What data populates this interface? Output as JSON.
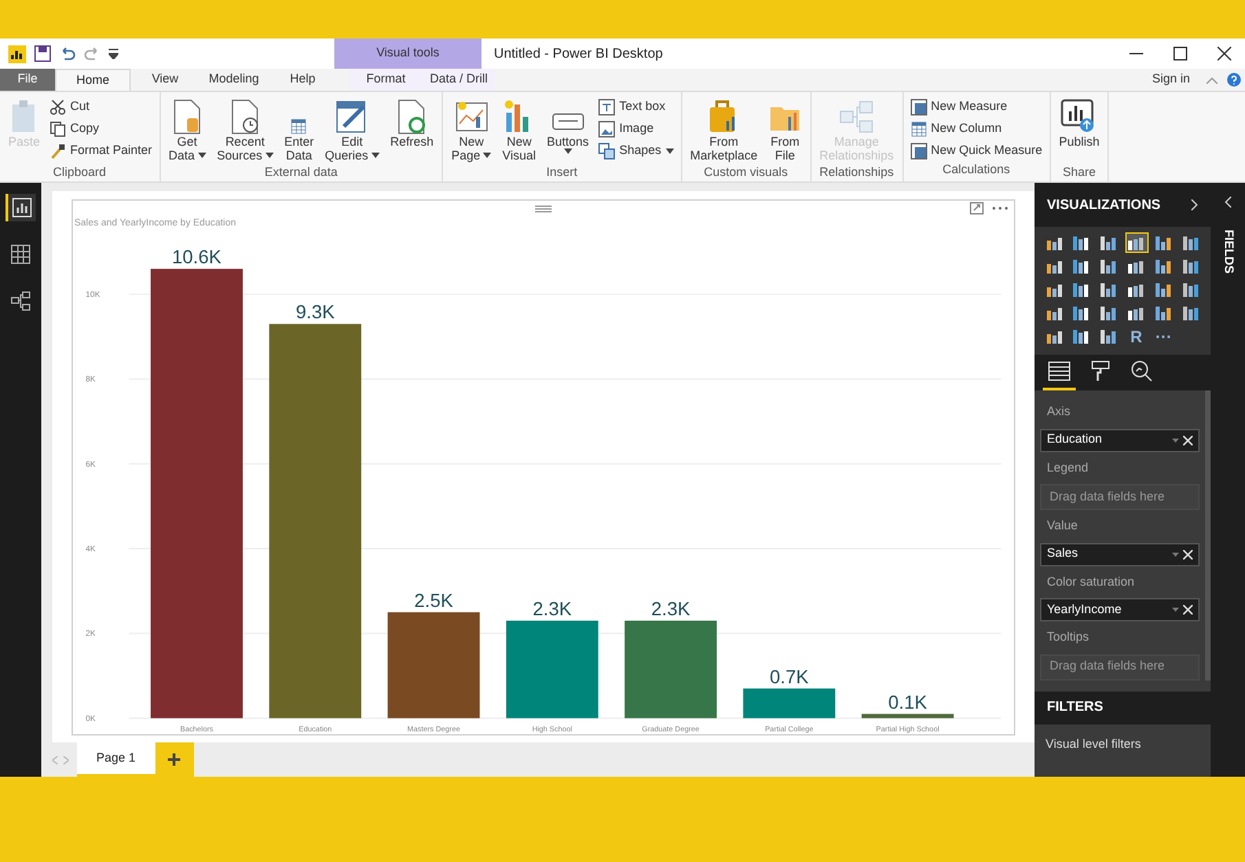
{
  "window": {
    "title": "Untitled - Power BI Desktop",
    "sign_in": "Sign in"
  },
  "context_header": "Visual tools",
  "tabs": [
    {
      "label": "File",
      "kind": "file",
      "selected": false
    },
    {
      "label": "Home",
      "kind": "tab",
      "selected": true
    },
    {
      "label": "View",
      "kind": "tab",
      "selected": false
    },
    {
      "label": "Modeling",
      "kind": "tab",
      "selected": false
    },
    {
      "label": "Help",
      "kind": "tab",
      "selected": false
    },
    {
      "label": "Format",
      "kind": "context",
      "selected": false
    },
    {
      "label": "Data / Drill",
      "kind": "context",
      "selected": false
    }
  ],
  "ribbon": [
    {
      "label": "Clipboard",
      "items": [
        {
          "kind": "large",
          "lines": [
            "Paste"
          ],
          "dropdown": false,
          "disabled": true
        },
        {
          "kind": "stack",
          "entries": [
            {
              "label": "Cut",
              "dropdown": false
            },
            {
              "label": "Copy",
              "dropdown": false
            },
            {
              "label": "Format Painter",
              "dropdown": false
            }
          ]
        }
      ]
    },
    {
      "label": "External data",
      "items": [
        {
          "kind": "large",
          "lines": [
            "Get",
            "Data"
          ],
          "dropdown": true,
          "disabled": false
        },
        {
          "kind": "large",
          "lines": [
            "Recent",
            "Sources"
          ],
          "dropdown": true,
          "disabled": false
        },
        {
          "kind": "large",
          "lines": [
            "Enter",
            "Data"
          ],
          "dropdown": false,
          "disabled": false
        },
        {
          "kind": "large",
          "lines": [
            "Edit",
            "Queries"
          ],
          "dropdown": true,
          "disabled": false
        },
        {
          "kind": "large",
          "lines": [
            "Refresh"
          ],
          "dropdown": false,
          "disabled": false
        }
      ]
    },
    {
      "label": "Insert",
      "items": [
        {
          "kind": "large",
          "lines": [
            "New",
            "Page"
          ],
          "dropdown": true,
          "disabled": false
        },
        {
          "kind": "large",
          "lines": [
            "New",
            "Visual"
          ],
          "dropdown": false,
          "disabled": false
        },
        {
          "kind": "large",
          "lines": [
            "Buttons"
          ],
          "dropdown": true,
          "disabled": false
        },
        {
          "kind": "stack",
          "entries": [
            {
              "label": "Text box",
              "dropdown": false
            },
            {
              "label": "Image",
              "dropdown": false
            },
            {
              "label": "Shapes",
              "dropdown": true
            }
          ]
        }
      ]
    },
    {
      "label": "Custom visuals",
      "items": [
        {
          "kind": "large",
          "lines": [
            "From",
            "Marketplace"
          ],
          "dropdown": false,
          "disabled": false
        },
        {
          "kind": "large",
          "lines": [
            "From",
            "File"
          ],
          "dropdown": false,
          "disabled": false
        }
      ]
    },
    {
      "label": "Relationships",
      "items": [
        {
          "kind": "large",
          "lines": [
            "Manage",
            "Relationships"
          ],
          "dropdown": false,
          "disabled": true
        }
      ]
    },
    {
      "label": "Calculations",
      "items": [
        {
          "kind": "stack",
          "entries": [
            {
              "label": "New Measure",
              "dropdown": false
            },
            {
              "label": "New Column",
              "dropdown": false
            },
            {
              "label": "New Quick Measure",
              "dropdown": false
            }
          ]
        }
      ]
    },
    {
      "label": "Share",
      "items": [
        {
          "kind": "large",
          "lines": [
            "Publish"
          ],
          "dropdown": false,
          "disabled": false
        }
      ]
    }
  ],
  "nav": [
    {
      "selected": true
    },
    {
      "selected": false
    },
    {
      "selected": false
    }
  ],
  "visual": {
    "title": "Sales and YearlyIncome by Education",
    "chart_data": {
      "type": "bar",
      "categories": [
        "Bachelors",
        "Education",
        "Masters Degree",
        "High School",
        "Graduate Degree",
        "Partial College",
        "Partial High School"
      ],
      "series": [
        {
          "color": "#7f2d2f",
          "values": [
            10600,
            null,
            null,
            null,
            null,
            null,
            null
          ]
        },
        {
          "color": "#6b6627",
          "values": [
            null,
            9300,
            null,
            null,
            null,
            null,
            null
          ]
        },
        {
          "color": "#7a4a22",
          "values": [
            null,
            null,
            2500,
            null,
            null,
            null,
            null
          ]
        },
        {
          "color": "#00857a",
          "values": [
            null,
            null,
            null,
            2300,
            null,
            700,
            null
          ]
        },
        {
          "color": "#377648",
          "values": [
            null,
            null,
            null,
            null,
            2300,
            null,
            null
          ]
        },
        {
          "color": "#4f6a3b",
          "values": [
            null,
            null,
            null,
            null,
            null,
            null,
            100
          ]
        }
      ],
      "grid": true,
      "ylim": [
        0,
        10600
      ],
      "yticks": [
        {
          "value": 0,
          "label": "0K"
        },
        {
          "value": 2000,
          "label": "2K"
        },
        {
          "value": 4000,
          "label": "4K"
        },
        {
          "value": 6000,
          "label": "6K"
        },
        {
          "value": 8000,
          "label": "8K"
        },
        {
          "value": 10000,
          "label": "10K"
        }
      ],
      "value_labels": [
        "10.6K",
        "9.3K",
        "2.5K",
        "2.3K",
        "2.3K",
        "0.7K",
        "0.1K"
      ]
    }
  },
  "pages": [
    {
      "label": "Page 1",
      "selected": true
    }
  ],
  "visualizations": {
    "title": "VISUALIZATIONS",
    "items": [
      {
        "selected": false
      },
      {
        "selected": false
      },
      {
        "selected": false
      },
      {
        "selected": true
      },
      {
        "selected": false
      },
      {
        "selected": false
      },
      {
        "selected": false
      },
      {
        "selected": false
      },
      {
        "selected": false
      },
      {
        "selected": false
      },
      {
        "selected": false
      },
      {
        "selected": false
      },
      {
        "selected": false
      },
      {
        "selected": false
      },
      {
        "selected": false
      },
      {
        "selected": false
      },
      {
        "selected": false
      },
      {
        "selected": false
      },
      {
        "selected": false
      },
      {
        "selected": false
      },
      {
        "selected": false
      },
      {
        "selected": false
      },
      {
        "selected": false
      },
      {
        "selected": false
      },
      {
        "selected": false
      },
      {
        "selected": false
      },
      {
        "selected": false
      },
      {
        "selected": false,
        "label": "R"
      },
      {
        "selected": false,
        "label": "···"
      }
    ],
    "pane_tabs": [
      {
        "selected": true
      },
      {
        "selected": false
      },
      {
        "selected": false
      }
    ],
    "wells": [
      {
        "label": "Axis",
        "field": "Education"
      },
      {
        "label": "Legend",
        "placeholder": "Drag data fields here"
      },
      {
        "label": "Value",
        "field": "Sales"
      },
      {
        "label": "Color saturation",
        "field": "YearlyIncome"
      },
      {
        "label": "Tooltips",
        "placeholder": "Drag data fields here"
      }
    ]
  },
  "filters": {
    "title": "FILTERS",
    "sections": [
      "Visual level filters"
    ]
  },
  "fields_pane": {
    "title": "FIELDS"
  }
}
